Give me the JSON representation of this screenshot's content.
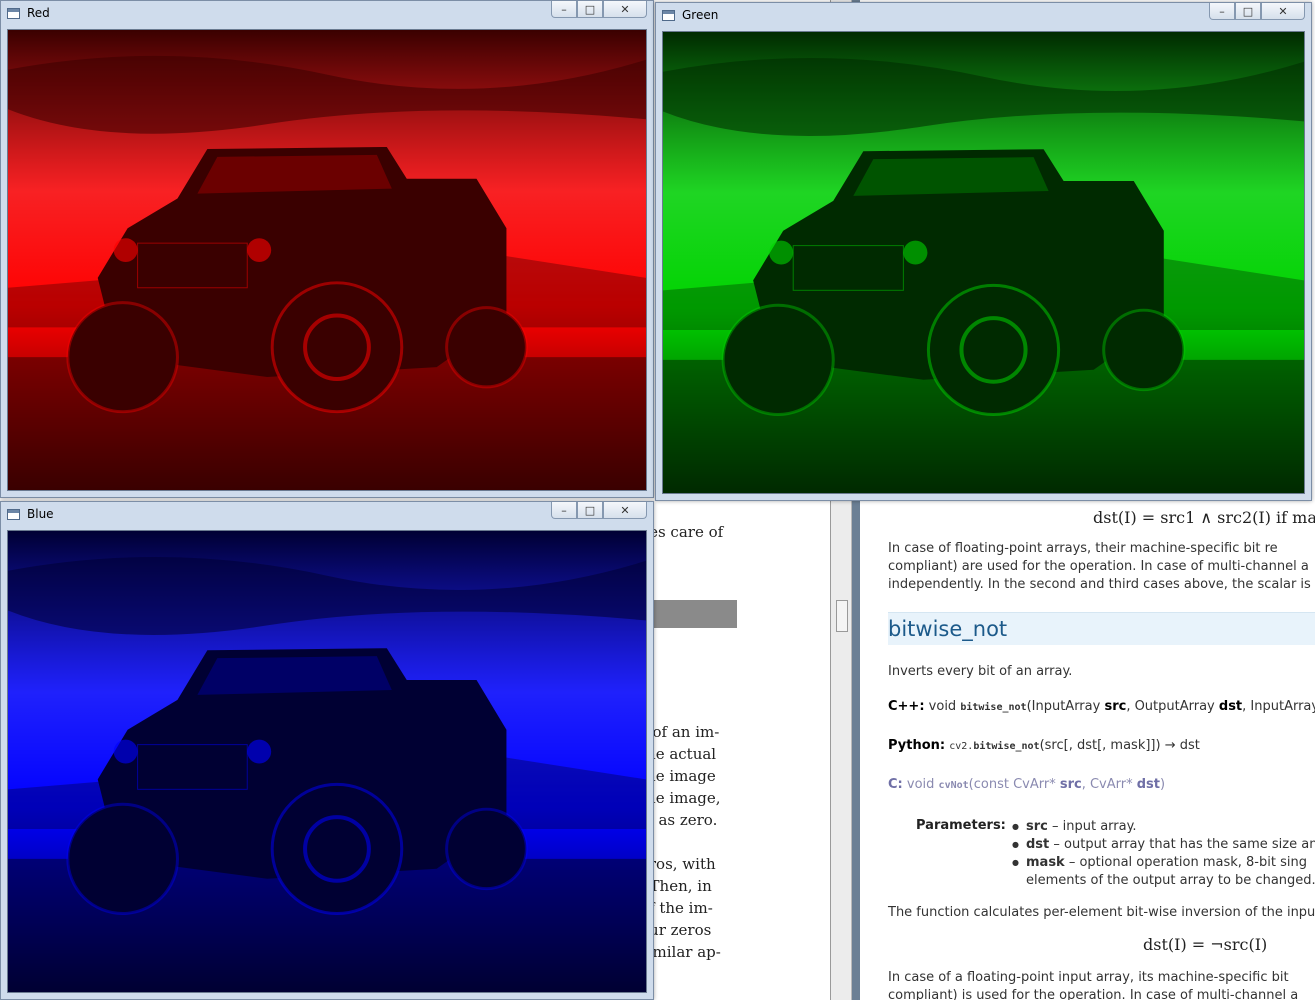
{
  "pdf_viewer": {
    "lines": [
      {
        "text": "kes care of"
      },
      {
        "text": "s of an im-"
      },
      {
        "text": "the actual"
      },
      {
        "text": "the image"
      },
      {
        "text": "the image,"
      },
      {
        "text": "el as zero."
      },
      {
        "text": "eros, with"
      },
      {
        "text": ". Then, in"
      },
      {
        "text": "of the im-"
      },
      {
        "text": "our zeros"
      },
      {
        "text": "similar ap-"
      }
    ]
  },
  "docs": {
    "formula_and": "dst(I) = src1 ∧ src2(I)   if ma",
    "para1": [
      "In case of floating-point arrays, their machine-specific bit re",
      "compliant) are used for the operation. In case of multi-channel a",
      "independently. In the second and third cases above, the scalar is f"
    ],
    "heading": "bitwise_not",
    "summary": "Inverts every bit of an array.",
    "cpp": {
      "label": "C++:",
      "ret": "void",
      "fn": "bitwise_not",
      "args_pre": "(InputArray ",
      "a1": "src",
      "mid": ", OutputArray ",
      "a2": "dst",
      "post": ", InputArray"
    },
    "python": {
      "label": "Python:",
      "fn_prefix": "cv2.",
      "fn": "bitwise_not",
      "args": "(src[, dst[, mask]]) → dst"
    },
    "c": {
      "label": "C:",
      "ret": "void",
      "fn": "cvNot",
      "args_pre": "(const CvArr* ",
      "a1": "src",
      "mid": ", CvArr* ",
      "a2": "dst",
      "post": ")"
    },
    "params_label": "Parameters:",
    "params": [
      {
        "name": "src",
        "desc": " – input array."
      },
      {
        "name": "dst",
        "desc": " – output array that has the same size anc"
      },
      {
        "name": "mask",
        "desc": " – optional operation mask, 8-bit sing"
      },
      {
        "name": "",
        "desc": "elements of the output array to be changed."
      }
    ],
    "para2": "The function calculates per-element bit-wise inversion of the inpu",
    "formula_not": "dst(I) = ¬src(I)",
    "para3": [
      "In case of a floating-point input array, its machine-specific bit",
      "compliant) is used for the operation. In case of multi-channel a"
    ]
  },
  "windows": [
    {
      "id": "red",
      "title": "Red",
      "tint": "#ff0000",
      "dark": "#3a0000"
    },
    {
      "id": "green",
      "title": "Green",
      "tint": "#00d400",
      "dark": "#002a00"
    },
    {
      "id": "blue",
      "title": "Blue",
      "tint": "#0000ff",
      "dark": "#000033"
    }
  ],
  "window_buttons": {
    "minimize": "–",
    "maximize": "□",
    "close": "✕"
  }
}
